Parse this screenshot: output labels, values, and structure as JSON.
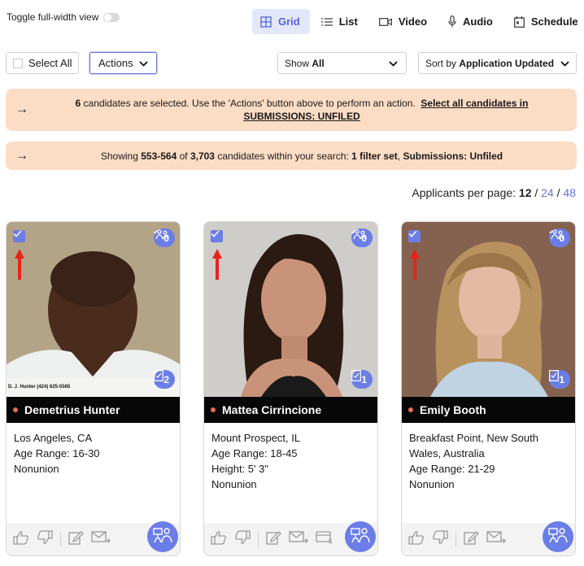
{
  "toggle": {
    "label": "Toggle full-width view"
  },
  "view_tabs": [
    {
      "label": "Grid",
      "icon": "grid-icon",
      "active": true
    },
    {
      "label": "List",
      "icon": "list-icon"
    },
    {
      "label": "Video",
      "icon": "video-icon"
    },
    {
      "label": "Audio",
      "icon": "microphone-icon"
    },
    {
      "label": "Schedule",
      "icon": "calendar-icon"
    }
  ],
  "toolbar": {
    "select_all": "Select All",
    "actions": "Actions",
    "show_prefix": "Show",
    "show_value": "All",
    "sort_prefix": "Sort by",
    "sort_value": "Application Updated"
  },
  "banner_selected": {
    "count": "6",
    "text": " candidates are selected. Use the 'Actions' button above to perform an action.",
    "link": "Select all candidates in SUBMISSIONS: UNFILED"
  },
  "banner_results": {
    "prefix": "Showing ",
    "range": "553-564",
    "of": " of ",
    "total": "3,703",
    "mid": " candidates within your search: ",
    "filters": "1 filter set",
    "sep": ", ",
    "filter_value": "Submissions: Unfiled"
  },
  "per_page": {
    "label": "Applicants per page: ",
    "current": "12",
    "divider": " / ",
    "option_2": "24",
    "option_3": "48"
  },
  "candidates": [
    {
      "name": "Demetrius Hunter",
      "details": [
        "Los Angeles, CA",
        "Age Range: 16-30",
        "Nonunion"
      ],
      "top_badge": "0",
      "bottom_badge": "2",
      "photo_caption": "D. J. Hunter (424) 625-5565",
      "selected": true
    },
    {
      "name": "Mattea Cirrincione",
      "details": [
        "Mount Prospect, IL",
        "Age Range: 18-45",
        "Height: 5' 3\"",
        "Nonunion"
      ],
      "top_badge": "0",
      "bottom_badge": "1",
      "selected": true
    },
    {
      "name": "Emily Booth",
      "details": [
        "Breakfast Point, New South Wales, Australia",
        "Age Range: 21-29",
        "Nonunion"
      ],
      "top_badge": "0",
      "bottom_badge": "1",
      "selected": true
    }
  ],
  "colors": {
    "accent": "#6b7de6",
    "banner": "#fbdcc5",
    "name_bar": "#070707",
    "status_dot": "#ee6b4d",
    "pointer_arrow": "#e8231a"
  }
}
